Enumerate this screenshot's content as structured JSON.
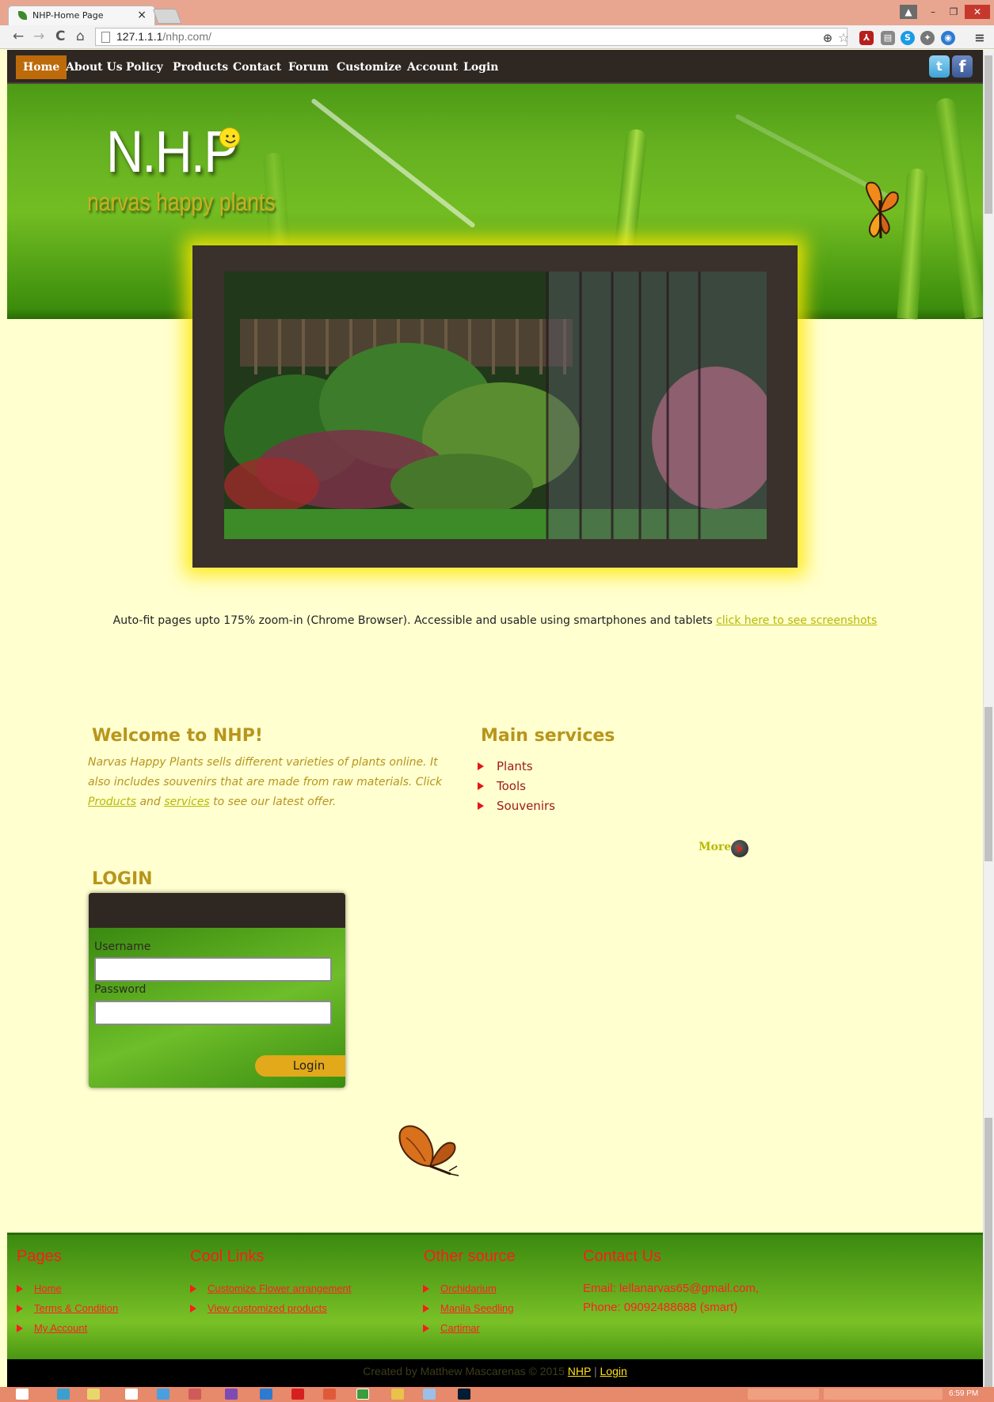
{
  "browser": {
    "tab_title": "NHP-Home Page",
    "tab_close": "×",
    "url_host": "127.1.1.1",
    "url_path": "/nhp.com/",
    "window_controls": {
      "minimize": "–",
      "maximize": "❐",
      "close": "✕"
    },
    "nav_icons": {
      "back": "←",
      "forward": "→",
      "reload": "C",
      "home": "⌂"
    },
    "extension_icons": [
      "zoom-icon",
      "star-icon",
      "pdf-icon",
      "document-icon",
      "skype-icon",
      "puzzle-icon",
      "globe-icon",
      "menu-icon"
    ]
  },
  "navbar": {
    "items": [
      {
        "label": "Home",
        "active": true
      },
      {
        "label": "About Us",
        "active": false
      },
      {
        "label": "Policy",
        "active": false
      },
      {
        "label": "Products",
        "active": false
      },
      {
        "label": "Contact",
        "active": false
      },
      {
        "label": "Forum",
        "active": false
      },
      {
        "label": "Customize",
        "active": false
      },
      {
        "label": "Account",
        "active": false
      },
      {
        "label": "Login",
        "active": false
      }
    ],
    "social": {
      "twitter": "t",
      "facebook": "f"
    },
    "active_color": "#bd6a0b",
    "bar_color": "#2e2722"
  },
  "logo": {
    "title": "N.H.P",
    "subtitle": "narvas happy plants"
  },
  "info": {
    "text": "Auto-fit pages upto 175% zoom-in (Chrome Browser). Accessible and usable using smartphones and tablets ",
    "link": "click here to see screenshots"
  },
  "welcome": {
    "heading": "Welcome to NHP!",
    "text_before": "Narvas Happy Plants sells different varieties of plants online. It also includes souvenirs that are made from raw materials. Click ",
    "products_link": "Products",
    "text_mid": " and ",
    "services_link": "services",
    "text_after": " to see our latest offer."
  },
  "services": {
    "heading": "Main services",
    "items": [
      "Plants",
      "Tools",
      "Souvenirs"
    ],
    "more": "More"
  },
  "login": {
    "heading": "LOGIN",
    "username_label": "Username",
    "password_label": "Password",
    "username_value": "",
    "password_value": "",
    "button": "Login"
  },
  "footer": {
    "pages": {
      "heading": "Pages",
      "items": [
        "Home",
        "Terms & Condition",
        "My Account"
      ]
    },
    "cool_links": {
      "heading": "Cool Links",
      "items": [
        "Customize Flower arrangement",
        "View customized products"
      ]
    },
    "other_source": {
      "heading": "Other source",
      "items": [
        "Orchidarium",
        "Manila Seedling",
        "Cartimar"
      ]
    },
    "contact": {
      "heading": "Contact Us",
      "email": "Email: lellanarvas65@gmail.com,",
      "phone": "Phone: 09092488688 (smart)"
    },
    "credits": "Created by Matthew Mascarenas © 2015 ",
    "credits_link_nhp": "NHP",
    "credits_sep": " | ",
    "credits_link_login": "Login"
  },
  "taskbar": {
    "clock": "6:59 PM"
  },
  "colors": {
    "page_background": "#ffffd0",
    "heading": "#b8951c",
    "link": "#b7b900",
    "footer_text": "#ff1a1a",
    "service_text": "#9c1a1a"
  }
}
